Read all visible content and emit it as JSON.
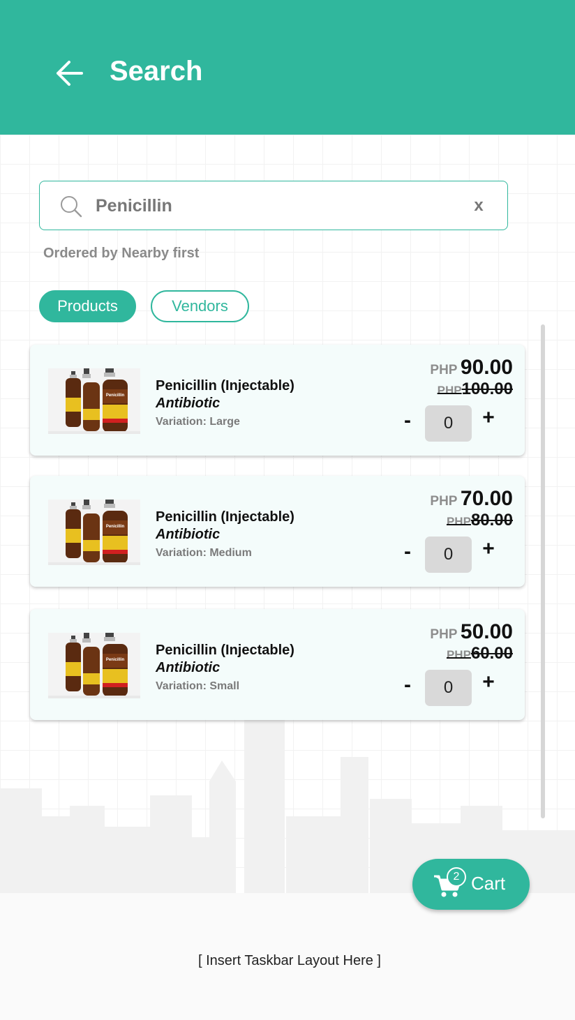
{
  "colors": {
    "accent": "#30b79d",
    "card_bg": "#f4fcfb"
  },
  "header": {
    "title": "Search",
    "back_icon": "arrow-left-icon"
  },
  "search": {
    "value": "Penicillin",
    "clear_label": "x",
    "icon": "search-icon"
  },
  "order_note": "Ordered by Nearby first",
  "tabs": [
    {
      "label": "Products",
      "active": true
    },
    {
      "label": "Vendors",
      "active": false
    }
  ],
  "products": [
    {
      "name": "Penicillin (Injectable)",
      "category": "Antibiotic",
      "variation": "Variation: Large",
      "currency": "PHP",
      "price": "90.00",
      "old_price": "100.00",
      "qty": "0"
    },
    {
      "name": "Penicillin (Injectable)",
      "category": "Antibiotic",
      "variation": "Variation: Medium",
      "currency": "PHP",
      "price": "70.00",
      "old_price": "80.00",
      "qty": "0"
    },
    {
      "name": "Penicillin (Injectable)",
      "category": "Antibiotic",
      "variation": "Variation: Small",
      "currency": "PHP",
      "price": "50.00",
      "old_price": "60.00",
      "qty": "0"
    }
  ],
  "controls": {
    "minus": "-",
    "plus": "+"
  },
  "bottle_labels": {
    "big": "Penicillin",
    "small": "Penicillin"
  },
  "cart": {
    "label": "Cart",
    "count": "2",
    "icon": "cart-icon"
  },
  "taskbar_note": "[ Insert Taskbar Layout Here ]"
}
